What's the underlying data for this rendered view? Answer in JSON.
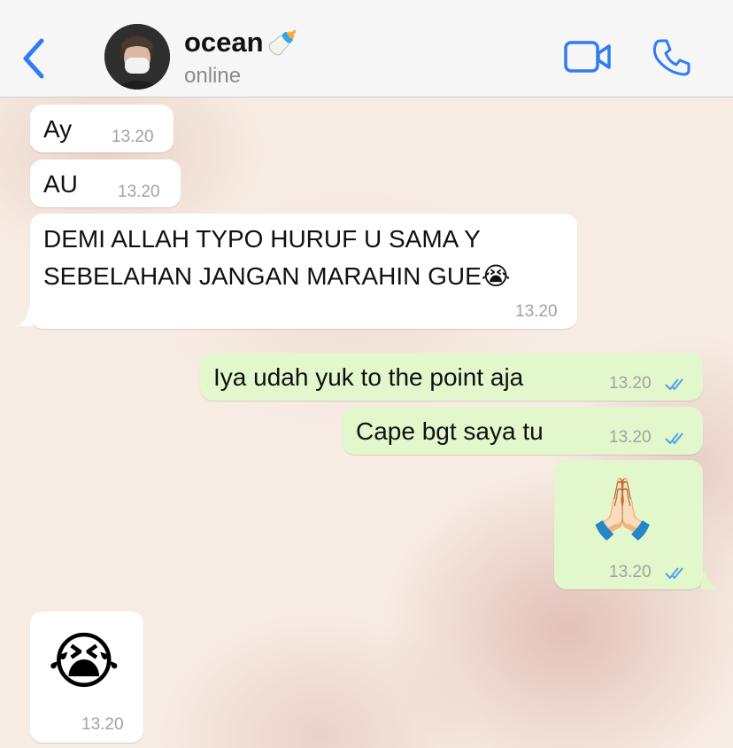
{
  "header": {
    "contact_name": "ocean",
    "contact_status": "online",
    "name_emoji": "🍼"
  },
  "messages": [
    {
      "direction": "in",
      "text": "Ay",
      "time": "13.20"
    },
    {
      "direction": "in",
      "text": "AU",
      "time": "13.20"
    },
    {
      "direction": "in",
      "text_line1": "DEMI ALLAH TYPO HURUF U SAMA Y",
      "text_line2": "SEBELAHAN JANGAN MARAHIN GUE😭",
      "time": "13.20"
    },
    {
      "direction": "out",
      "text": "Iya udah yuk to the point aja",
      "time": "13.20",
      "status": "read"
    },
    {
      "direction": "out",
      "text": "Cape bgt saya tu",
      "time": "13.20",
      "status": "read"
    },
    {
      "direction": "out",
      "emoji": "🙏🏻",
      "time": "13.20",
      "status": "read"
    },
    {
      "direction": "in",
      "emoji": "😭",
      "time": "13.20"
    }
  ],
  "colors": {
    "accent": "#2f7cf6",
    "incoming_bubble": "#ffffff",
    "outgoing_bubble": "#e2f7cb",
    "read_check": "#4fa3e8"
  },
  "icons": {
    "back": "chevron-left-icon",
    "video": "video-camera-icon",
    "call": "phone-icon",
    "read": "double-check-icon"
  }
}
